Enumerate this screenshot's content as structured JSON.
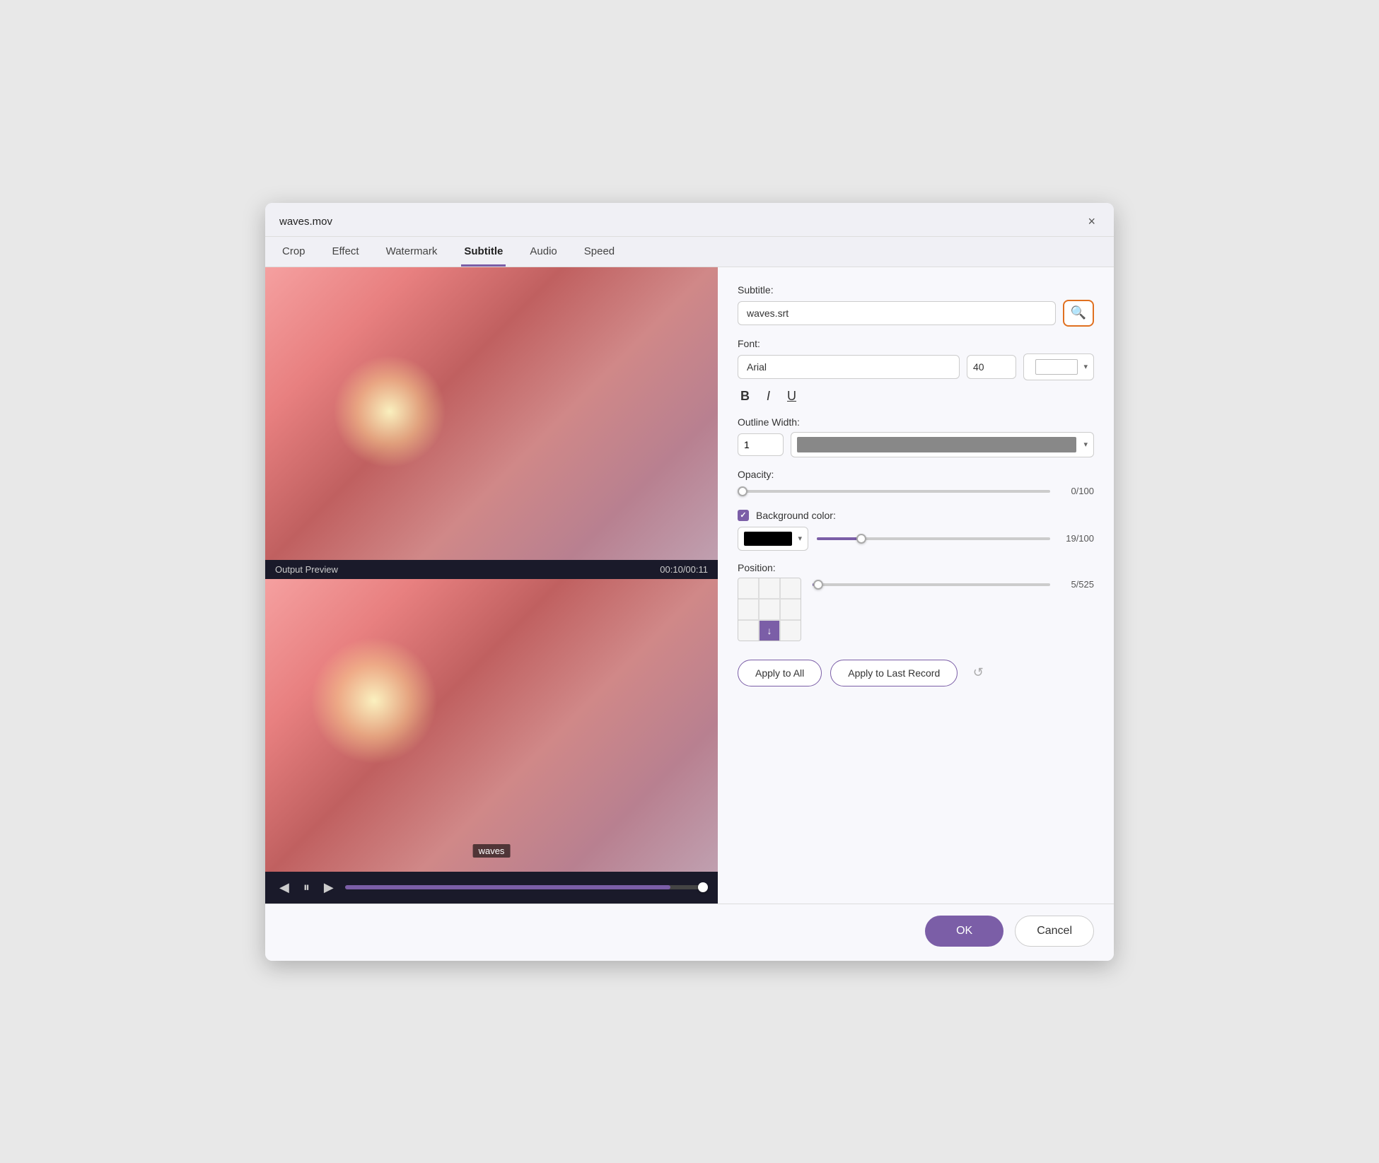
{
  "titleBar": {
    "title": "waves.mov",
    "closeLabel": "×"
  },
  "tabs": [
    {
      "id": "crop",
      "label": "Crop",
      "active": false
    },
    {
      "id": "effect",
      "label": "Effect",
      "active": false
    },
    {
      "id": "watermark",
      "label": "Watermark",
      "active": false
    },
    {
      "id": "subtitle",
      "label": "Subtitle",
      "active": true
    },
    {
      "id": "audio",
      "label": "Audio",
      "active": false
    },
    {
      "id": "speed",
      "label": "Speed",
      "active": false
    }
  ],
  "videoPanel": {
    "previewLabel": "Output Preview",
    "timeCode": "00:10/00:11",
    "subtitleWatermark": "waves"
  },
  "settings": {
    "subtitleLabel": "Subtitle:",
    "subtitleFile": "waves.srt",
    "fontLabel": "Font:",
    "fontValue": "Arial",
    "fontSizeValue": "40",
    "outlineWidthLabel": "Outline Width:",
    "outlineWidthValue": "1",
    "opacityLabel": "Opacity:",
    "opacityValue": "0/100",
    "opacityPercent": 0,
    "bgColorLabel": "Background color:",
    "bgOpacityValue": "19/100",
    "bgOpacityPercent": 19,
    "positionLabel": "Position:",
    "positionValue": "5/525",
    "positionPercent": 1,
    "applyAllLabel": "Apply to All",
    "applyLastLabel": "Apply to Last Record"
  },
  "bottomButtons": {
    "okLabel": "OK",
    "cancelLabel": "Cancel"
  },
  "icons": {
    "search": "🔍",
    "bold": "B",
    "italic": "I",
    "underline": "U",
    "refresh": "↺",
    "positionDown": "↓",
    "play": "▶",
    "pause": "⏸",
    "prev": "◀",
    "next": "▶"
  }
}
